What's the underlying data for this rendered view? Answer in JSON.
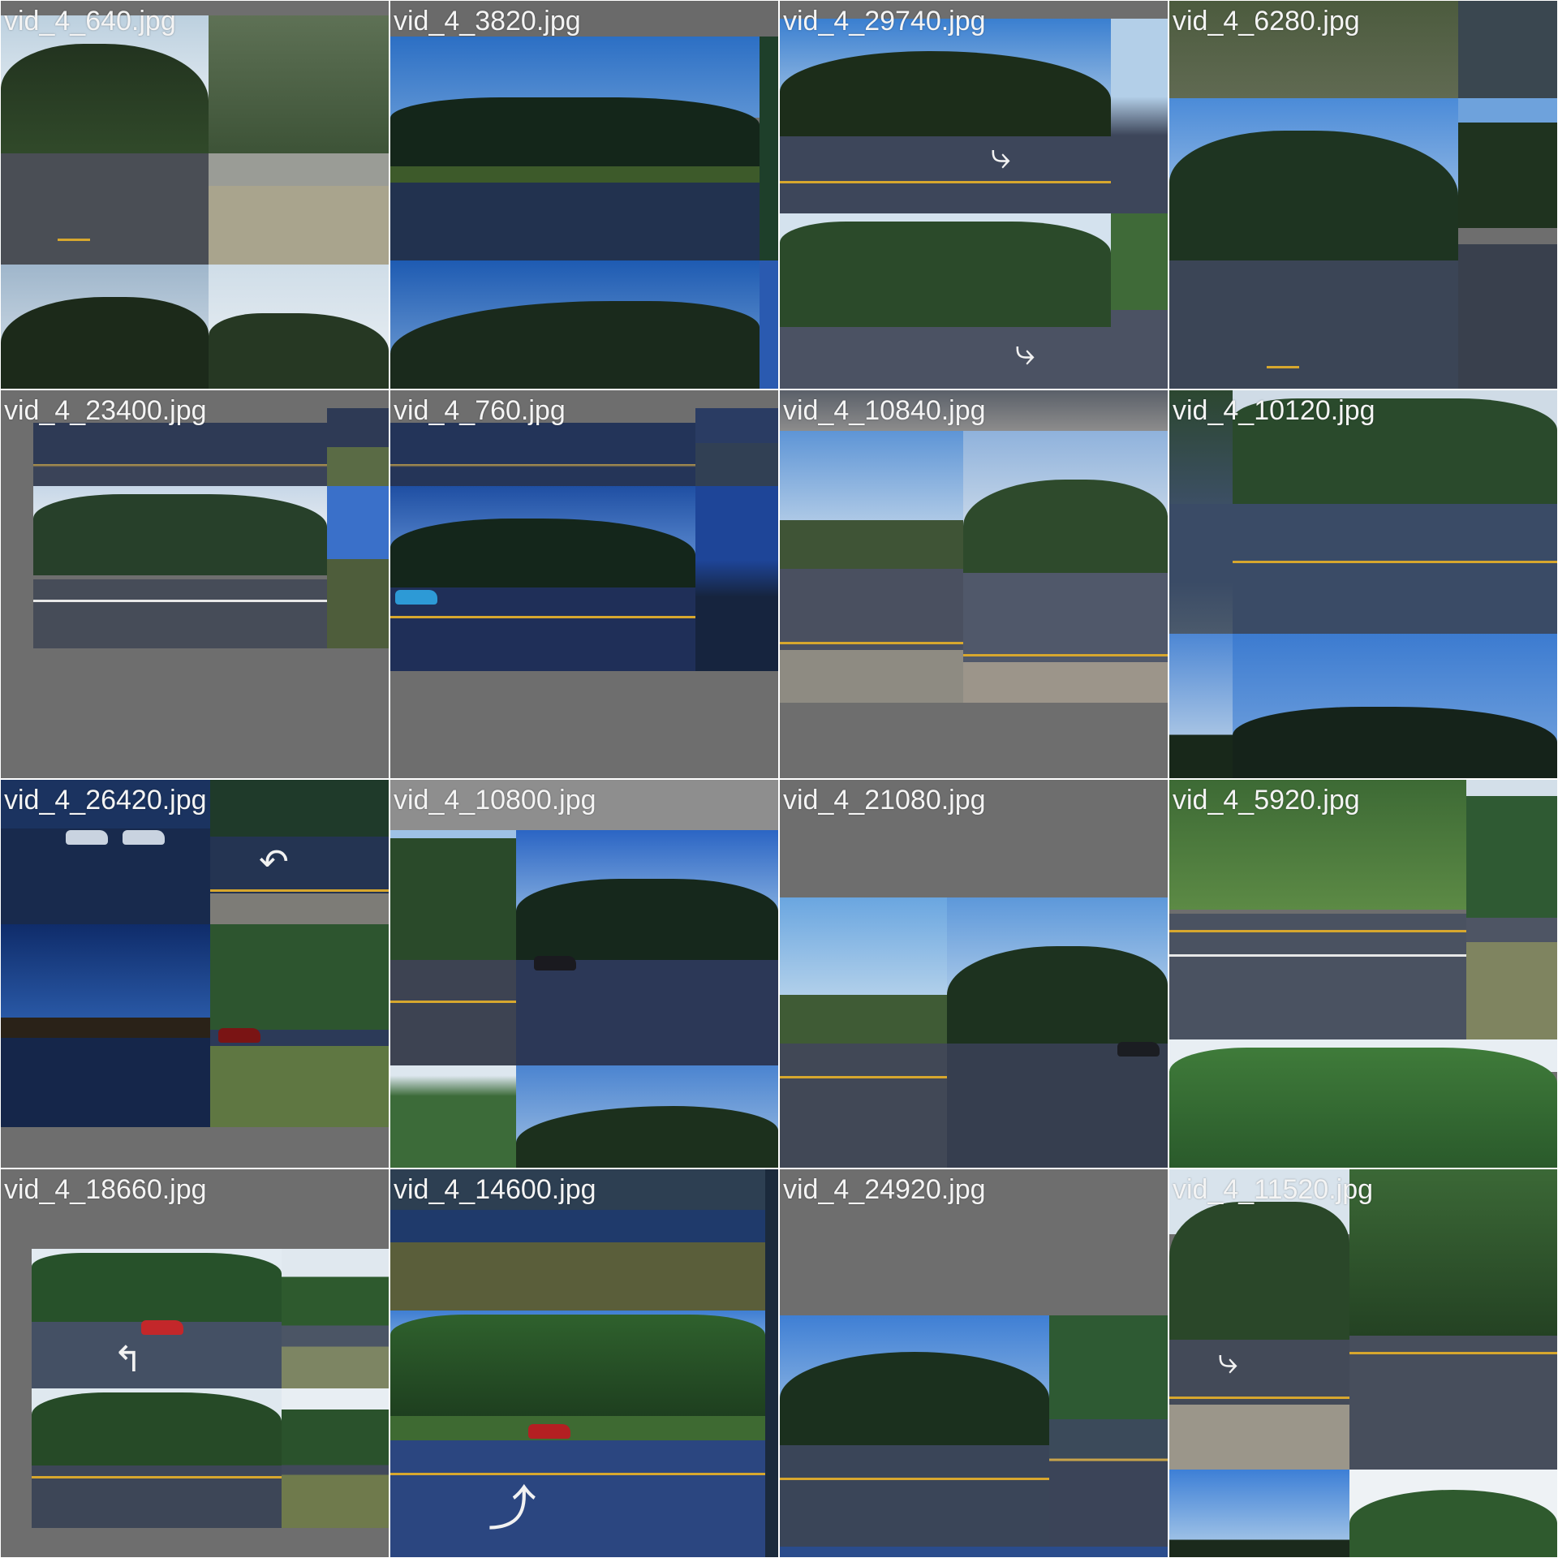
{
  "tiles": [
    {
      "label": "vid_4_640.jpg"
    },
    {
      "label": "vid_4_3820.jpg"
    },
    {
      "label": "vid_4_29740.jpg"
    },
    {
      "label": "vid_4_6280.jpg"
    },
    {
      "label": "vid_4_23400.jpg"
    },
    {
      "label": "vid_4_760.jpg"
    },
    {
      "label": "vid_4_10840.jpg"
    },
    {
      "label": "vid_4_10120.jpg"
    },
    {
      "label": "vid_4_26420.jpg"
    },
    {
      "label": "vid_4_10800.jpg"
    },
    {
      "label": "vid_4_21080.jpg"
    },
    {
      "label": "vid_4_5920.jpg"
    },
    {
      "label": "vid_4_18660.jpg"
    },
    {
      "label": "vid_4_14600.jpg"
    },
    {
      "label": "vid_4_24920.jpg"
    },
    {
      "label": "vid_4_11520.jpg"
    }
  ],
  "colors": {
    "tile_background": "#6e6e6e",
    "grid_background": "#ffffff",
    "label_text": "#f4f4f4",
    "road_yellow_line": "#d7a72e"
  }
}
